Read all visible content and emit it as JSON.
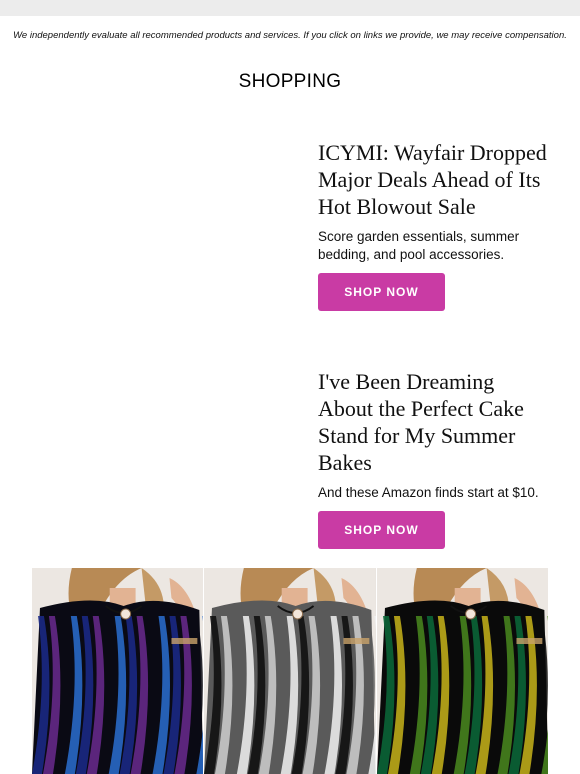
{
  "disclaimer": "We independently evaluate all recommended products and services. If you click on links we provide, we may receive compensation.",
  "section_title": "SHOPPING",
  "articles": [
    {
      "title": "ICYMI: Wayfair Dropped Major Deals Ahead of Its Hot Blowout Sale",
      "description": "Score garden essentials, summer bedding, and pool accessories.",
      "button": "SHOP NOW"
    },
    {
      "title": "I've Been Dreaming About the Perfect Cake Stand for My Summer Bakes",
      "description": "And these Amazon finds start at $10.",
      "button": "SHOP NOW"
    }
  ],
  "colors": {
    "accent": "#c93ba4",
    "topbar": "#ececec"
  },
  "product_images": [
    {
      "name": "blue-purple-print-dress",
      "colors": [
        "#1b2a8a",
        "#6a2a8e",
        "#0a0a14",
        "#2a6fd0"
      ]
    },
    {
      "name": "black-white-print-dress",
      "colors": [
        "#0c0c0c",
        "#cfcfcf",
        "#5a5a5a",
        "#f2f2f2"
      ]
    },
    {
      "name": "green-yellow-print-dress",
      "colors": [
        "#0b6a3a",
        "#c8b41a",
        "#0a0a0a",
        "#4a8a1e"
      ]
    }
  ]
}
